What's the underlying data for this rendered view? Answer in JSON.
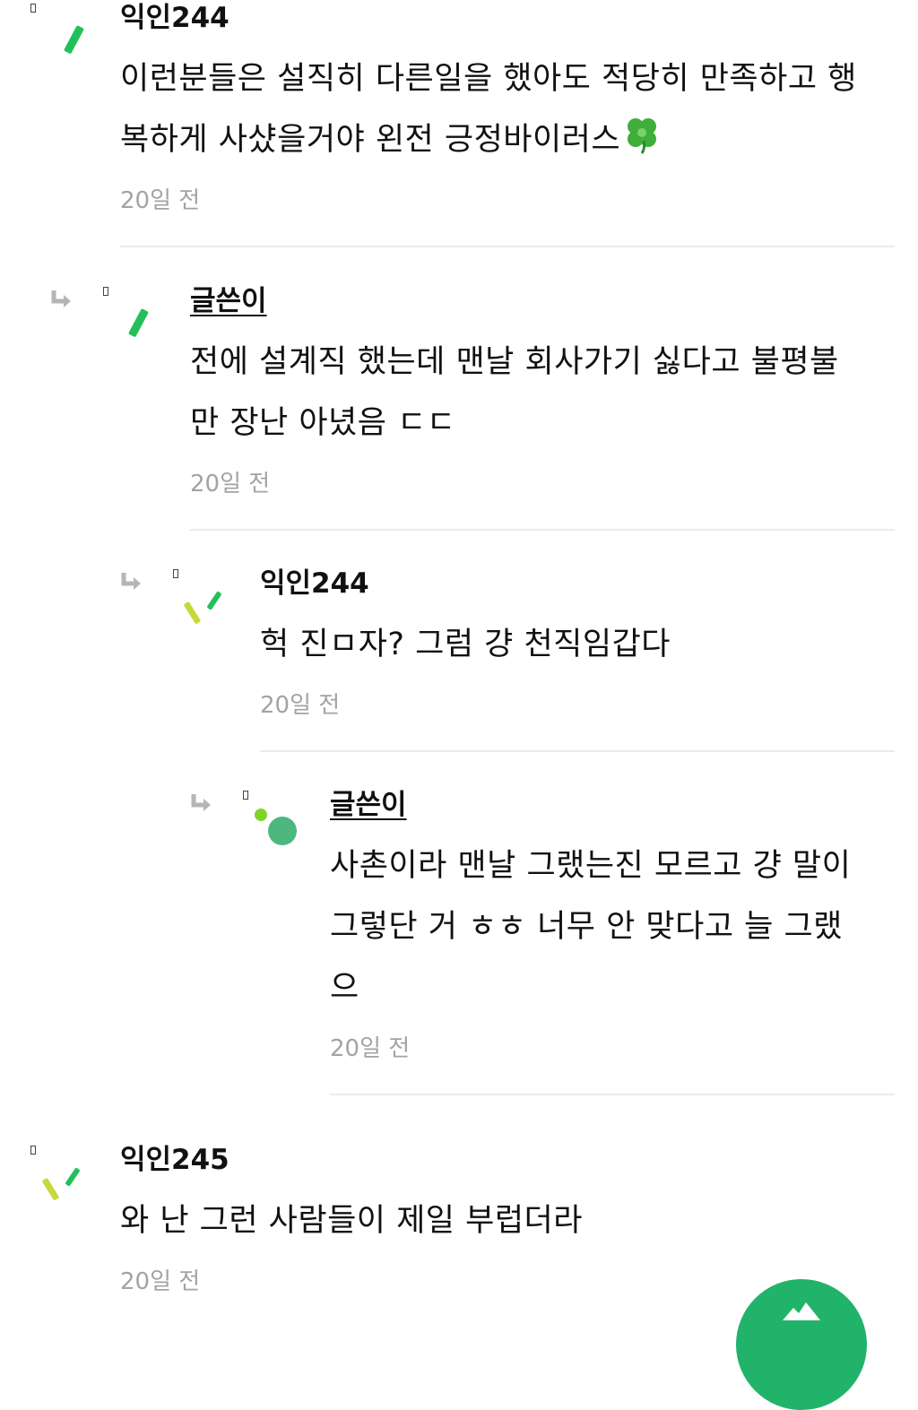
{
  "comments": [
    {
      "author": "익인244",
      "body_line1": "이런분들은 설직히 다른일을 했아도 적당히 만족하고 행",
      "body_line2": "복하게 사샸을거야 왼전 긍정바이러스",
      "time": "20일 전"
    },
    {
      "author": "글쓴이",
      "body_line1": "전에 설계직 했는데 맨날 회사가기 싫다고 불평불",
      "body_line2": "만 장난 아녔음 ㄷㄷ",
      "time": "20일 전"
    },
    {
      "author": "익인244",
      "body_line1": "헉 진ㅁ자? 그럼 걍 천직임갑다",
      "time": "20일 전"
    },
    {
      "author": "글쓴이",
      "body_line1": "사촌이라 맨날 그랬는진 모르고 걍 말이",
      "body_line2": "그렇단 거 ㅎㅎ 너무 안 맞다고 늘 그랬",
      "body_line3": "으",
      "time": "20일 전"
    },
    {
      "author": "익인245",
      "body_line1": "와 난 그런 사람들이 제일 부럽더라",
      "time": "20일 전"
    }
  ],
  "icons": {
    "reply": "reply-arrow-icon",
    "clover": "four-leaf-clover-icon",
    "fab": "floating-action-button"
  },
  "colors": {
    "avatar_green": "#22c05a",
    "avatar_lime": "#c8d83a",
    "avatar_teal": "#4cb87e",
    "fab_green": "#22b36a",
    "time_gray": "#a3a3a3",
    "divider": "#ebebeb"
  }
}
